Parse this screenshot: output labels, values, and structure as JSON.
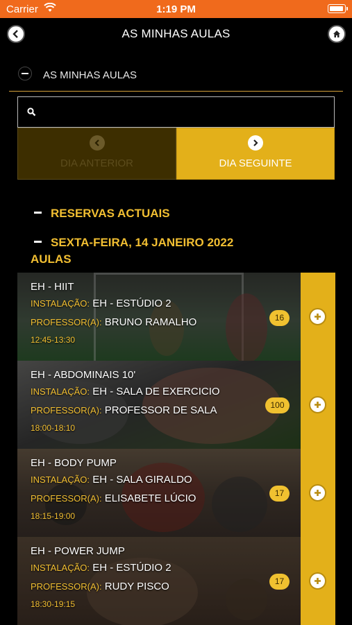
{
  "status_bar": {
    "carrier": "Carrier",
    "time": "1:19 PM"
  },
  "nav": {
    "title": "AS MINHAS AULAS"
  },
  "section": {
    "title": "AS MINHAS AULAS"
  },
  "search": {
    "placeholder": ""
  },
  "day_nav": {
    "previous": "DIA ANTERIOR",
    "next": "DIA SEGUINTE"
  },
  "groups": {
    "reservations": "RESERVAS ACTUAIS",
    "date": "SEXTA-FEIRA, 14 JANEIRO 2022",
    "classes_label": "AULAS"
  },
  "labels": {
    "location": "INSTALAÇÃO:",
    "teacher": "PROFESSOR(A):"
  },
  "classes": [
    {
      "name": "EH - HIIT",
      "location": "EH - ESTÚDIO 2",
      "teacher": "BRUNO RAMALHO",
      "time": "12:45-13:30",
      "count": "16"
    },
    {
      "name": "EH - ABDOMINAIS 10'",
      "location": "EH - SALA DE EXERCICIO",
      "teacher": "PROFESSOR DE SALA",
      "time": "18:00-18:10",
      "count": "100"
    },
    {
      "name": "EH - BODY PUMP",
      "location": "EH - SALA GIRALDO",
      "teacher": "ELISABETE LÚCIO",
      "time": "18:15-19:00",
      "count": "17"
    },
    {
      "name": "EH - POWER JUMP",
      "location": "EH - ESTÚDIO 2",
      "teacher": "RUDY PISCO",
      "time": "18:30-19:15",
      "count": "17"
    }
  ],
  "colors": {
    "accent": "#e3b01a",
    "label": "#f2bf32",
    "status_bar": "#f06a1c"
  }
}
